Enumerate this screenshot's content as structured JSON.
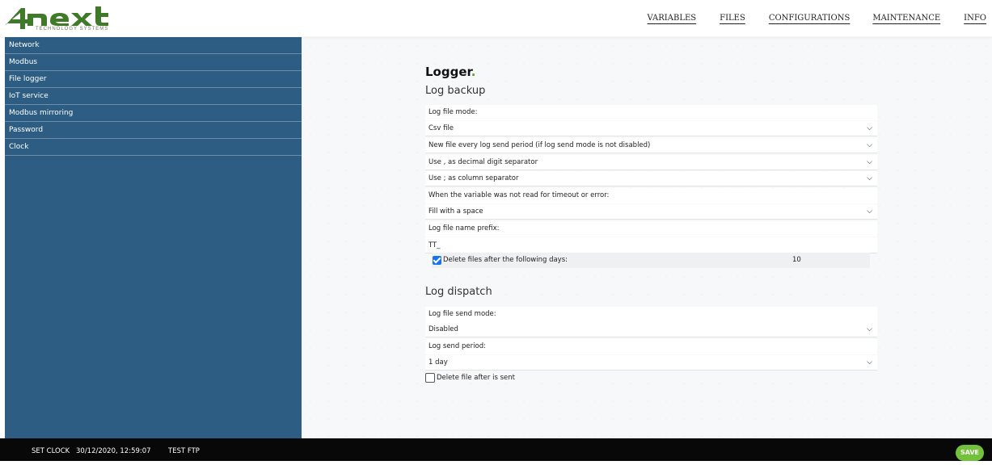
{
  "logo": {
    "tagline": "TECHNOLOGY SYSTEMS",
    "brand_color": "#3f7a28"
  },
  "topnav": [
    "VARIABLES",
    "FILES",
    "CONFIGURATIONS",
    "MAINTENANCE",
    "INFO"
  ],
  "sidebar": {
    "items": [
      "Network",
      "Modbus",
      "File logger",
      "IoT service",
      "Modbus mirroring",
      "Password",
      "Clock"
    ]
  },
  "page": {
    "title": "Logger",
    "title_dot": ".",
    "backup": {
      "heading": "Log backup",
      "mode_label": "Log file mode:",
      "mode_value": "Csv file",
      "new_file_value": "New file every log send period (if log send mode is not disabled)",
      "decimal_value": "Use , as decimal digit separator",
      "column_value": "Use ; as column separator",
      "missing_label": "When the variable was not read for timeout or error:",
      "missing_value": "Fill with a space",
      "prefix_label": "Log file name prefix:",
      "prefix_value": "TT_",
      "delete_label": "Delete files after the following days:",
      "delete_checked": true,
      "delete_days": "10"
    },
    "dispatch": {
      "heading": "Log dispatch",
      "send_mode_label": "Log file send mode:",
      "send_mode_value": "Disabled",
      "send_period_label": "Log send period:",
      "send_period_value": "1 day",
      "delete_after_label": "Delete file after is sent",
      "delete_after_checked": false
    }
  },
  "footer": {
    "set_clock": "SET CLOCK",
    "datetime": "30/12/2020, 12:59:07",
    "test_ftp": "TEST FTP",
    "save": "SAVE"
  },
  "colors": {
    "sidebar_bg": "#2d5d82",
    "accent_green": "#72c13a",
    "checkbox_blue": "#1a73e8"
  }
}
